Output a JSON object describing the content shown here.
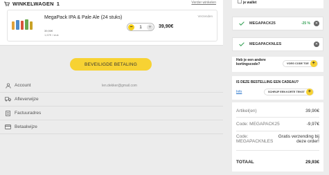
{
  "cart": {
    "title": "WINKELWAGEN",
    "count": "1",
    "continue_link": "Verder winkelen",
    "item": {
      "title": "MegaPack IPA & Pale Ale (24 stuks)",
      "unit_price": "39,90€",
      "unit_info": "1,67€ / stuk",
      "vendor": "Verzenden",
      "quantity": "1",
      "line_total": "39,90€"
    }
  },
  "checkout_button": "BEVEILIGDE BETALING",
  "details": [
    {
      "label": "Account",
      "value": "len.dekker@gmail.com",
      "icon": "user-icon"
    },
    {
      "label": "Afleverwijze",
      "value": "",
      "icon": "truck-icon"
    },
    {
      "label": "Factuuradres",
      "value": "",
      "icon": "document-icon"
    },
    {
      "label": "Betaalwijze",
      "value": "",
      "icon": "card-icon"
    }
  ],
  "sidebar": {
    "wallet_text": "je wallet",
    "codes": [
      {
        "name": "MEGAPACK25",
        "discount": "-25 %"
      },
      {
        "name": "MEGAPACKNLES",
        "discount": ""
      }
    ],
    "promo_question": "Heb je een andere kortingscode?",
    "promo_button": "VOEG CODE TOE",
    "gift_question": "IS DEZE BESTELLING EEN CADEAU?",
    "gift_info": "Info",
    "gift_button": "SCHRIJF EEN KORTE TEKST",
    "summary": {
      "items_label": "Artikel(en)",
      "items_value": "39,90€",
      "code1_label": "Code: MEGAPACK25",
      "code1_value": "-9,97€",
      "code2_label": "Code: MEGAPACKNLES",
      "code2_value": "Gratis verzending bij deze order!",
      "total_label": "TOTAAL",
      "total_value": "29,93€"
    }
  },
  "colors": {
    "accent": "#f7d233",
    "success": "#3aa35a",
    "link": "#1f6fc8"
  }
}
